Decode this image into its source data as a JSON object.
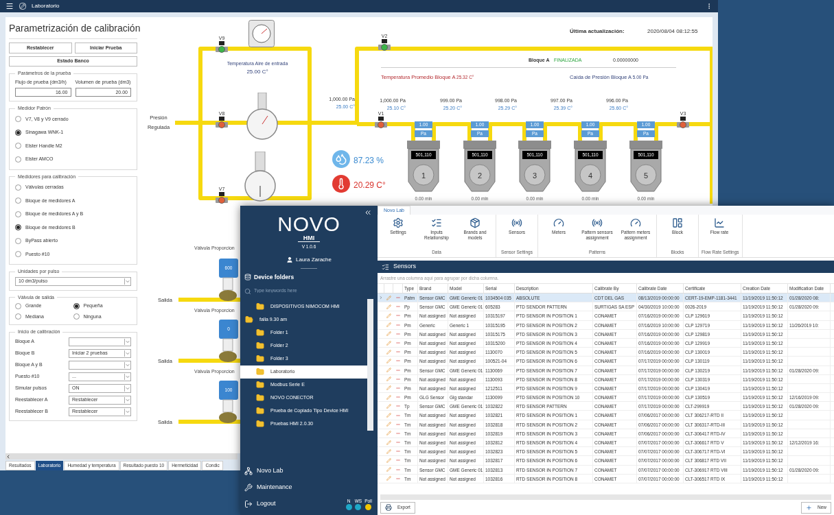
{
  "back_window": {
    "title": "Laboratorio",
    "heading": "Parametrización de calibración",
    "buttons": [
      {
        "label": "Restablecer"
      },
      {
        "label": "Iniciar Prueba"
      },
      {
        "label": "Estado Banco"
      }
    ],
    "test_parameters": {
      "title": "Parámetros de la prueba",
      "fields": [
        {
          "label": "Flujo de prueba (dm3/h)",
          "value": "16.00"
        },
        {
          "label": "Volumen de prueba (dm3)",
          "value": "20.00"
        }
      ]
    },
    "pattern_meter": {
      "title": "Medidor Patrón",
      "options": [
        {
          "label": "V7, V8 y V9 cerrado",
          "selected": false
        },
        {
          "label": "Sinagawa WNK-1",
          "selected": true
        },
        {
          "label": "Elster Handle M2",
          "selected": false
        },
        {
          "label": "Elster AMCO",
          "selected": false
        }
      ]
    },
    "calibration_meters": {
      "title": "Medidores para calibración",
      "options": [
        {
          "label": "Válvulas cerradas",
          "selected": false
        },
        {
          "label": "Bloque de medidores A",
          "selected": false
        },
        {
          "label": "Bloque de medidores A y B",
          "selected": false
        },
        {
          "label": "Bloque de medidores B",
          "selected": true
        },
        {
          "label": "ByPass abierto",
          "selected": false
        },
        {
          "label": "Puesto #10",
          "selected": false
        }
      ]
    },
    "pulse_units": {
      "title": "Unidades por pulso",
      "value": "10 dm3/pulso"
    },
    "outlet_valve": {
      "title": "Válvula de salida",
      "options": [
        {
          "label": "Grande",
          "selected": false
        },
        {
          "label": "Pequeña",
          "selected": true
        },
        {
          "label": "Mediana",
          "selected": false
        },
        {
          "label": "Ninguna",
          "selected": false
        }
      ]
    },
    "calibration_start": {
      "title": "Inicio de calibración",
      "rows": [
        {
          "label": "Bloque A",
          "value": null
        },
        {
          "label": "Bloque B",
          "value": "Iniciar 2 pruebas"
        },
        {
          "label": "Bloque A y B",
          "value": null
        },
        {
          "label": "Puesto #10",
          "value": "..."
        },
        {
          "label": "Simular pulsos",
          "value": "ON"
        },
        {
          "label": "Reestablecer A",
          "value": "Restablecer"
        },
        {
          "label": "Reestablecer B",
          "value": "Restablecer"
        }
      ]
    },
    "tabs": [
      {
        "label": "Resultados",
        "selected": false
      },
      {
        "label": "Laboratorio",
        "selected": true
      },
      {
        "label": "Humedad y temperatura",
        "selected": false
      },
      {
        "label": "Resultado puesto 10",
        "selected": false
      },
      {
        "label": "Hermeticidad",
        "selected": false
      },
      {
        "label": "Condic",
        "selected": false
      }
    ],
    "diagram": {
      "last_update": {
        "label": "Última actualización:",
        "value": "2020/08/04 08:12:55"
      },
      "valves": [
        {
          "label": "V9",
          "open": true
        },
        {
          "label": "V8",
          "open": false
        },
        {
          "label": "V7",
          "open": false
        },
        {
          "label": "V2",
          "open": true
        },
        {
          "label": "V1",
          "open": false
        },
        {
          "label": "V3",
          "open": false
        }
      ],
      "inlet_air": {
        "label": "Temperatura Aire de entrada",
        "value": "25.00 C°"
      },
      "regulated_pressure": "Presión Regulada",
      "inlet_reading": {
        "pressure": "1,000.00 Pa",
        "temperature": "25.00 C°"
      },
      "block": {
        "label": "Bloque A",
        "status": "FINALIZADA",
        "value": "0.00000000",
        "avg_temp_label": "Temperatura Promedio Bloque A",
        "avg_temp": "25.32 C°",
        "pressure_drop_label": "Caída de Presión Bloque A",
        "pressure_drop": "5.00",
        "pressure_drop_unit": "Pa"
      },
      "humidity": "87.23 %",
      "temperature": "20.29 C°",
      "meters": [
        {
          "number": "1",
          "display": "501,110",
          "pressure": "1,000.00 Pa",
          "temperature": "25.10 C°",
          "tag_value": "1.00",
          "tag_unit": "Pa",
          "time": "0.00 min"
        },
        {
          "number": "2",
          "display": "501,110",
          "pressure": "999.00 Pa",
          "temperature": "25.20 C°",
          "tag_value": "1.00",
          "tag_unit": "Pa",
          "time": "0.00 min"
        },
        {
          "number": "3",
          "display": "501,110",
          "pressure": "998.00 Pa",
          "temperature": "25.29 C°",
          "tag_value": "1.00",
          "tag_unit": "Pa",
          "time": "0.00 min"
        },
        {
          "number": "4",
          "display": "501,110",
          "pressure": "997.00 Pa",
          "temperature": "25.39 C°",
          "tag_value": "1.00",
          "tag_unit": "Pa",
          "time": "0.00 min"
        },
        {
          "number": "5",
          "display": "501,110",
          "pressure": "996.00 Pa",
          "temperature": "25.60 C°",
          "tag_value": "1.00",
          "tag_unit": "Pa",
          "time": "0.00 min"
        }
      ],
      "proportional_valves": [
        {
          "label": "Válvula Proporcion",
          "value": "600",
          "outlet": "Salida"
        },
        {
          "label": "Válvula Proporcion",
          "value": "0",
          "outlet": "Salida"
        },
        {
          "label": "Válvula Proporcion",
          "value": "100",
          "outlet": "Salida"
        }
      ]
    }
  },
  "front_window": {
    "logo": {
      "name": "NOVO",
      "sub": "HMI",
      "version": "V 1.0.6"
    },
    "user": "Laura Zarache",
    "folders_title": "Device folders",
    "search_placeholder": "Type keywords here",
    "tree": [
      {
        "label": "DISPOSITIVOS NIMOCOM HMI",
        "selected": false
      },
      {
        "label": "falla 9.30 am",
        "selected": false,
        "expanded": true,
        "children": [
          {
            "label": "Folder 1",
            "selected": false
          },
          {
            "label": "Folder 2",
            "selected": false
          },
          {
            "label": "Folder 3",
            "selected": false
          },
          {
            "label": "Laboratorio",
            "selected": true
          },
          {
            "label": "Modbus Serie E",
            "selected": false
          },
          {
            "label": "NOVO CONECTOR",
            "selected": false
          },
          {
            "label": "Prueba de Copiado Tipo Device HMI",
            "selected": false
          },
          {
            "label": "Pruebas HMI 2.0.30",
            "selected": false
          }
        ]
      }
    ],
    "nav": [
      {
        "label": "Novo Lab",
        "kind": "lab"
      },
      {
        "label": "Maintenance",
        "kind": "tools"
      },
      {
        "label": "Logout",
        "kind": "logout"
      }
    ],
    "status": [
      {
        "label": "N",
        "color": "#1ea8c8"
      },
      {
        "label": "WS",
        "color": "#1ea8c8"
      },
      {
        "label": "Poll",
        "color": "#f2c500"
      }
    ],
    "ribbon": {
      "tabs": [
        {
          "label": "Novo Lab",
          "selected": true
        }
      ],
      "groups": [
        {
          "title": "Data",
          "items": [
            {
              "label": "Settings",
              "kind": "gear"
            },
            {
              "label": "Inputs Relationship",
              "kind": "list"
            },
            {
              "label": "Brands and models",
              "kind": "box"
            }
          ]
        },
        {
          "title": "Sensor Settings",
          "items": [
            {
              "label": "Sensors",
              "kind": "sensor"
            }
          ]
        },
        {
          "title": "Patterns",
          "items": [
            {
              "label": "Meters",
              "kind": "meter"
            },
            {
              "label": "Pattern sensors assignment",
              "kind": "sensor"
            },
            {
              "label": "Pattern meters assignment",
              "kind": "meter"
            }
          ]
        },
        {
          "title": "Blocks",
          "items": [
            {
              "label": "Block",
              "kind": "block"
            }
          ]
        },
        {
          "title": "Flow Rate Settings",
          "items": [
            {
              "label": "Flow rate",
              "kind": "chart"
            }
          ]
        }
      ]
    },
    "panel_title": "Sensors",
    "group_hint": "Arrastre una columna aquí para agrupar por dicha columna.",
    "table": {
      "columns": [
        "Type",
        "Brand",
        "Model",
        "Serial",
        "Description",
        "Calibrate By",
        "Calibrate Date",
        "Certificate",
        "Creation Date",
        "Modification Date"
      ],
      "rows": [
        {
          "selected": true,
          "cells": [
            "Patm",
            "Sensor GMC",
            "GME Generic 01",
            "1034504 035",
            "ABSOLUTE",
            "CDT DEL GAS",
            "08/13/2019 00:00:00",
            "CERT-19-EMP-1181-3441",
            "11/19/2019 11:50:12",
            "01/28/2020 08:"
          ]
        },
        {
          "selected": false,
          "cells": [
            "Pp",
            "Sensor GMC",
            "GME Generic 01",
            "605283",
            "PTD SENDOR PATTERN",
            "SURTIGAS SA ESP",
            "04/30/2019 10:00:00",
            "0026-2019",
            "11/19/2019 11:50:12",
            "01/28/2020 09:"
          ]
        },
        {
          "selected": false,
          "cells": [
            "Pm",
            "Not assigned",
            "Not assigned",
            "10315197",
            "PTD SENSOR IN POSITION 1",
            "CONAMET",
            "07/16/2019 00:00:00",
            "CLP 129619",
            "11/19/2019 11:50:12",
            null
          ]
        },
        {
          "selected": false,
          "cells": [
            "Pm",
            "Generic",
            "Generic 1",
            "10315195",
            "PTD SENSOR IN POSITION 2",
            "CONAMET",
            "07/16/2019 10:00:00",
            "CLP 129719",
            "11/19/2019 11:50:12",
            "11/26/2019 10:"
          ]
        },
        {
          "selected": false,
          "cells": [
            "Pm",
            "Not assigned",
            "Not assigned",
            "10315175",
            "PTD SENSOR IN POSITION 3",
            "CONAMET",
            "07/16/2019 00:00:00",
            "CLP 129819",
            "11/19/2019 11:50:12",
            null
          ]
        },
        {
          "selected": false,
          "cells": [
            "Pm",
            "Not assigned",
            "Not assigned",
            "10315200",
            "PTD SENSOR IN POSITION 4",
            "CONAMET",
            "07/16/2019 00:00:00",
            "CLP 129919",
            "11/19/2019 11:50:12",
            null
          ]
        },
        {
          "selected": false,
          "cells": [
            "Pm",
            "Not assigned",
            "Not assigned",
            "1130070",
            "PTD SENSOR IN POSITION 5",
            "CONAMET",
            "07/16/2019 00:00:00",
            "CLP 130019",
            "11/19/2019 11:50:12",
            null
          ]
        },
        {
          "selected": false,
          "cells": [
            "Pm",
            "Not assigned",
            "Not assigned",
            "100521-04",
            "PTD SENSOR IN POSITION 6",
            "CONAMET",
            "07/17/2019 00:00:00",
            "CLP 130119",
            "11/19/2019 11:50:12",
            null
          ]
        },
        {
          "selected": false,
          "cells": [
            "Pm",
            "Sensor GMC",
            "GME Generic 01",
            "1130069",
            "PTD SENSOR IN POSITION 7",
            "CONAMET",
            "07/17/2019 00:00:00",
            "CLP 130219",
            "11/19/2019 11:50:12",
            "01/28/2020 09:"
          ]
        },
        {
          "selected": false,
          "cells": [
            "Pm",
            "Not assigned",
            "Not assigned",
            "1130093",
            "PTD SENSOR IN POSITION 8",
            "CONAMET",
            "07/17/2019 00:00:00",
            "CLP 130319",
            "11/19/2019 11:50:12",
            null
          ]
        },
        {
          "selected": false,
          "cells": [
            "Pm",
            "Not assigned",
            "Not assigned",
            "1212511",
            "PTD SENSOR IN POSITION 9",
            "CONAMET",
            "07/17/2019 00:00:00",
            "CLP 130419",
            "11/19/2019 11:50:12",
            null
          ]
        },
        {
          "selected": false,
          "cells": [
            "Pm",
            "GLG Sensor",
            "Glg standar",
            "1130099",
            "PTD SENSOR IN POSITION 10",
            "CONAMET",
            "07/17/2019 00:00:00",
            "CLP 130519",
            "11/19/2019 11:50:12",
            "12/16/2019 09:"
          ]
        },
        {
          "selected": false,
          "cells": [
            "Tp",
            "Sensor GMC",
            "GME Generic 01",
            "1032822",
            "RTD SENSOR PATTERN",
            "CONAMET",
            "07/17/2019 00:00:00",
            "CLT-299919",
            "11/19/2019 11:50:12",
            "01/28/2020 09:"
          ]
        },
        {
          "selected": false,
          "cells": [
            "Tm",
            "Not assigned",
            "Not assigned",
            "1032821",
            "RTD SENSOR IN POSITION 1",
            "CONAMET",
            "07/06/2017 00:00:00",
            "CLT 306217-RTD II",
            "11/19/2019 11:50:12",
            null
          ]
        },
        {
          "selected": false,
          "cells": [
            "Tm",
            "Not assigned",
            "Not assigned",
            "1032818",
            "RTD SENSOR IN POSITION 2",
            "CONAMET",
            "07/06/2017 00:00:00",
            "CLT 306317-RTD-III",
            "11/19/2019 11:50:12",
            null
          ]
        },
        {
          "selected": false,
          "cells": [
            "Tm",
            "Not assigned",
            "Not assigned",
            "1032819",
            "RTD SENSOR IN POSITION 3",
            "CONAMET",
            "07/06/2017 00:00:00",
            "CLT-306417 RTD-IV",
            "11/19/2019 11:50:12",
            null
          ]
        },
        {
          "selected": false,
          "cells": [
            "Tm",
            "Not assigned",
            "Not assigned",
            "1032812",
            "RTD SENSOR IN POSITION 4",
            "CONAMET",
            "07/07/2017 00:00:00",
            "CLT-306617 RTD V",
            "11/19/2019 11:50:12",
            "12/12/2019 16:"
          ]
        },
        {
          "selected": false,
          "cells": [
            "Tm",
            "Not assigned",
            "Not assigned",
            "1032823",
            "RTD SENSOR IN POSITION 5",
            "CONAMET",
            "07/07/2017 00:00:00",
            "CLT-306717 RTD-VI",
            "11/19/2019 11:50:12",
            null
          ]
        },
        {
          "selected": false,
          "cells": [
            "Tm",
            "Not assigned",
            "Not assigned",
            "1032817",
            "RTD SENSOR IN POSITION 6",
            "CONAMET",
            "07/07/2017 00:00:00",
            "CLT 306817 RTD VII",
            "11/19/2019 11:50:12",
            null
          ]
        },
        {
          "selected": false,
          "cells": [
            "Tm",
            "Sensor GMC",
            "GME Generic 01",
            "1032813",
            "RTD SENSOR IN POSITION 7",
            "CONAMET",
            "07/07/2017 00:00:00",
            "CLT-306917 RTD VIII",
            "11/19/2019 11:50:12",
            "01/28/2020 09:"
          ]
        },
        {
          "selected": false,
          "cells": [
            "Tm",
            "Not assigned",
            "Not assigned",
            "1032816",
            "RTD SENSOR IN POSITION 8",
            "CONAMET",
            "07/07/2017 00:00:00",
            "CLT-306517 RTD IX",
            "11/19/2019 11:50:12",
            null
          ]
        }
      ]
    },
    "buttons": [
      {
        "label": "Export",
        "kind": "export"
      },
      {
        "label": "New",
        "kind": "add"
      }
    ]
  }
}
